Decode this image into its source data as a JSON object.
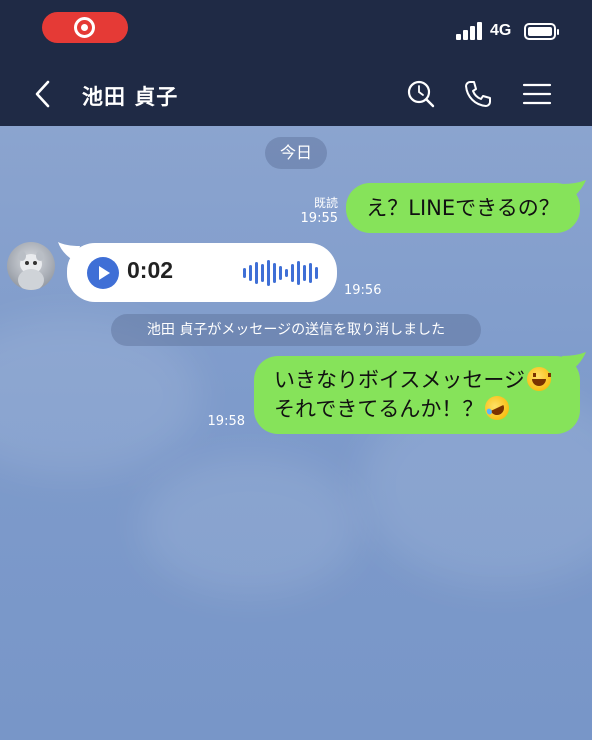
{
  "status_bar": {
    "recording_indicator": "screen-recording-icon",
    "network": "4G"
  },
  "header": {
    "contact_name": "池田 貞子",
    "icons": [
      "chevron-left-icon",
      "search-icon",
      "phone-icon",
      "menu-icon"
    ]
  },
  "chat": {
    "date_label": "今日",
    "messages": [
      {
        "sender": "me",
        "text": "え？LINEできるの？",
        "read_label": "既読",
        "time": "19:55"
      },
      {
        "sender": "contact",
        "type": "voice",
        "duration": "0:02",
        "time": "19:56"
      },
      {
        "sender": "system",
        "text": "池田 貞子がメッセージの送信を取り消しました"
      },
      {
        "sender": "me",
        "line1": "いきなりボイスメッセージ",
        "line2": "それできてるんか！？",
        "emoji1": "grinning-squinting-face-icon",
        "emoji2": "rolling-on-floor-laughing-icon",
        "time": "19:58"
      }
    ]
  },
  "colors": {
    "header_bg": "#1f2a45",
    "chat_bg": "#7e9bcb",
    "my_bubble": "#86e35a",
    "contact_bubble": "#ffffff",
    "record_pill": "#e53a36",
    "accent_blue": "#3f6fd6"
  }
}
